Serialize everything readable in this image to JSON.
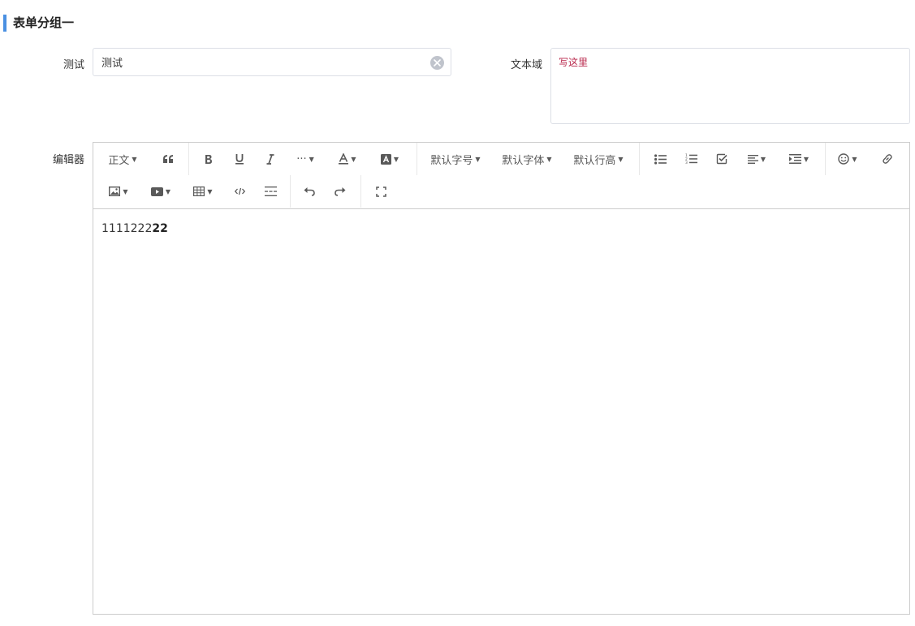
{
  "section": {
    "title": "表单分组一"
  },
  "fields": {
    "test": {
      "label": "测试",
      "value": "测试"
    },
    "textarea": {
      "label": "文本域",
      "placeholder": "写这里"
    },
    "editor": {
      "label": "编辑器"
    }
  },
  "toolbar": {
    "heading": "正文",
    "font_size": "默认字号",
    "font_family": "默认字体",
    "line_height": "默认行高",
    "ellipsis": "···"
  },
  "editor_content": {
    "normal": "1111222",
    "bold": "22"
  },
  "icons": {
    "quote": "quote-icon",
    "bold": "bold-icon",
    "underline": "underline-icon",
    "italic": "italic-icon",
    "more": "more-style-icon",
    "font_color": "font-color-icon",
    "bg_color": "bg-color-icon",
    "bullet_list": "bullet-list-icon",
    "numbered_list": "numbered-list-icon",
    "todo": "todo-icon",
    "align": "align-icon",
    "indent": "indent-icon",
    "emoji": "emoji-icon",
    "link": "link-icon",
    "image": "image-icon",
    "video": "video-icon",
    "table": "table-icon",
    "code": "code-icon",
    "divider": "divider-icon",
    "undo": "undo-icon",
    "redo": "redo-icon",
    "fullscreen": "fullscreen-icon",
    "clear": "clear-icon"
  },
  "colors": {
    "accent": "#4a90e2",
    "placeholder": "#b8264a",
    "border": "#dcdfe6"
  }
}
